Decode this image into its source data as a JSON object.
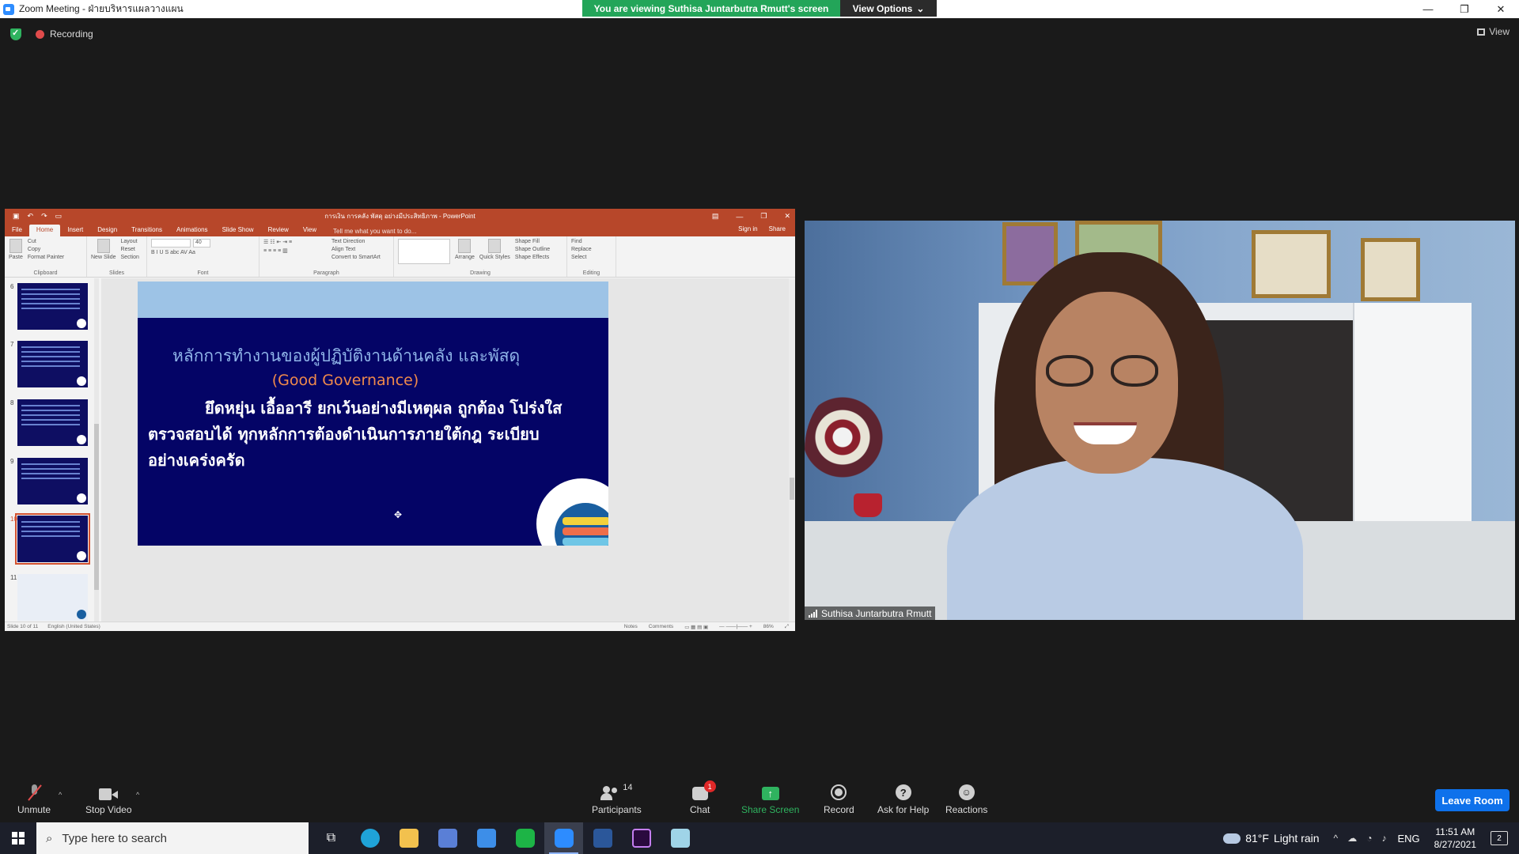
{
  "window": {
    "title": "Zoom Meeting - ฝ่ายบริหารแผลวางแผน",
    "controls": [
      "—",
      "❐",
      "✕"
    ]
  },
  "banner": {
    "viewing_text": "You are viewing Suthisa  Juntarbutra Rmutt's screen",
    "view_options_label": "View Options",
    "banner_color": "#23a559"
  },
  "status": {
    "recording_label": "Recording",
    "view_label": "View"
  },
  "powerpoint": {
    "doc_title": "การเงิน การคลัง พัสดุ อย่างมีประสิทธิภาพ - PowerPoint",
    "tabs": [
      "File",
      "Home",
      "Insert",
      "Design",
      "Transitions",
      "Animations",
      "Slide Show",
      "Review",
      "View"
    ],
    "active_tab": "Home",
    "tell_me": "Tell me what you want to do...",
    "sign_in": "Sign in",
    "share": "Share",
    "ribbon": {
      "clipboard": {
        "paste": "Paste",
        "cut": "Cut",
        "copy": "Copy",
        "format_painter": "Format Painter",
        "group": "Clipboard"
      },
      "slides": {
        "new_slide": "New Slide",
        "layout": "Layout",
        "reset": "Reset",
        "section": "Section",
        "group": "Slides"
      },
      "font": {
        "size": "40",
        "group": "Font"
      },
      "paragraph": {
        "text_direction": "Text Direction",
        "align_text": "Align Text",
        "convert": "Convert to SmartArt",
        "group": "Paragraph"
      },
      "drawing": {
        "arrange": "Arrange",
        "quick_styles": "Quick Styles",
        "shape_fill": "Shape Fill",
        "shape_outline": "Shape Outline",
        "shape_effects": "Shape Effects",
        "group": "Drawing"
      },
      "editing": {
        "find": "Find",
        "replace": "Replace",
        "select": "Select",
        "group": "Editing"
      }
    },
    "thumbnails": [
      {
        "num": "6"
      },
      {
        "num": "7"
      },
      {
        "num": "8"
      },
      {
        "num": "9"
      },
      {
        "num": "10"
      },
      {
        "num": "11"
      }
    ],
    "slide": {
      "heading": "หลักการทำงานของผู้ปฏิบัติงานด้านคลัง และพัสดุ",
      "subheading": "(Good Governance)",
      "body": "ยึดหยุ่น เอื้ออารี ยกเว้นอย่างมีเหตุผล ถูกต้อง โปร่งใส ตรวจสอบได้ ทุกหลักการต้องดำเนินการภายใต้กฎ ระเบียบ อย่างเคร่งครัด",
      "background_color": "#040466"
    },
    "statusbar": {
      "slide_of": "Slide 10 of 11",
      "language": "English (United States)",
      "notes": "Notes",
      "comments": "Comments",
      "zoom": "86%"
    }
  },
  "video": {
    "participant_name": "Suthisa  Juntarbutra Rmutt"
  },
  "toolbar": {
    "unmute": "Unmute",
    "stop_video": "Stop Video",
    "participants": "Participants",
    "participants_count": "14",
    "chat": "Chat",
    "chat_badge": "1",
    "share_screen": "Share Screen",
    "record": "Record",
    "ask_for_help": "Ask for Help",
    "reactions": "Reactions",
    "leave_room": "Leave Room",
    "leave_color": "#0e71eb"
  },
  "taskbar": {
    "search_placeholder": "Type here to search",
    "weather_temp": "81°F",
    "weather_desc": "Light rain",
    "language": "ENG",
    "time": "11:51 AM",
    "date": "8/27/2021",
    "notification_count": "2"
  }
}
